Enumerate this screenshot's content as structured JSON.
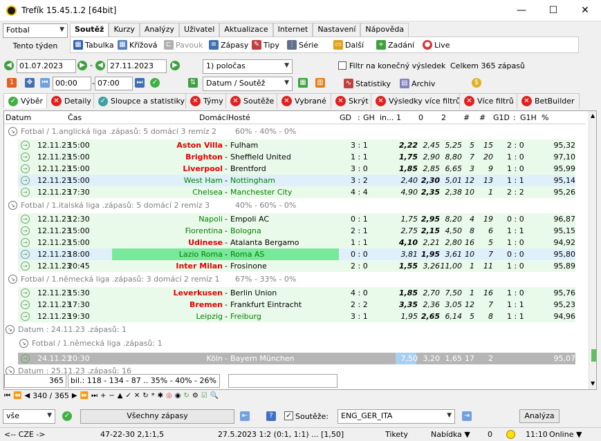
{
  "window": {
    "title": "Trefík 15.45.1.2 [64bit]"
  },
  "sport_select": "Fotbal",
  "period_button": "Tento týden",
  "menu_tabs": [
    "Soutěž",
    "Kurzy",
    "Analýzy",
    "Uživatel",
    "Aktualizace",
    "Internet",
    "Nastavení",
    "Nápověda"
  ],
  "toolbar": {
    "tabulka": "Tabulka",
    "krizova": "Křížová",
    "pavouk": "Pavouk",
    "zapasy": "Zápasy",
    "tipy": "Tipy",
    "serie": "Série",
    "dalsi": "Další",
    "zadani": "Zadání",
    "live": "Live"
  },
  "filters": {
    "date_from": "01.07.2023",
    "date_to": "27.11.2023",
    "time_from": "00:00",
    "time_to": "07:00",
    "half_select": "1) poločas",
    "sort_select": "Datum / Soutěž",
    "final_result_filter": "Filtr na konečný výsledek",
    "total": "Celkem 365 zápasů",
    "statistiky": "Statistiky",
    "archiv": "Archiv"
  },
  "result_tabs": [
    "Výběr",
    "Detaily",
    "Sloupce a statistiky",
    "Týmy",
    "Soutěže",
    "Vybrané",
    "Skrýt",
    "Výsledky více filtrů",
    "Více filtrů",
    "BetBuilder"
  ],
  "columns": [
    "Datum",
    "Čas",
    "Domácí",
    "Hosté",
    "GD",
    ":",
    "GH",
    "in...",
    "1",
    "0",
    "2",
    "#",
    "#",
    "G1D",
    ":",
    "G1H",
    "%"
  ],
  "groups": [
    {
      "label": "Fotbal / 1.anglická liga .zápasů: 5  domácí 3  remíz 2",
      "pct": "60% - 40% - 0%"
    },
    {
      "label": "Fotbal / 1.italská liga .zápasů: 5  domácí 2  remíz 3",
      "pct": "40% - 60% - 0%"
    },
    {
      "label": "Fotbal / 1.německá liga .zápasů: 3  domácí 2  remíz 1",
      "pct": "67% - 33% - 0%"
    }
  ],
  "date_group": "Datum : 24.11.23 .zápasů: 1",
  "date_group2": "Datum : 25.11.23 .zápasů: 16",
  "group4": "Fotbal / 1.německá liga .zápasů: 1",
  "matches": [
    [
      "12.11.23",
      "15:00",
      "Aston Villa",
      "Fulham",
      "3 : 1",
      "2,22",
      "2,45",
      "5,25",
      "5",
      "15",
      "2 : 0",
      "95,32"
    ],
    [
      "12.11.23",
      "15:00",
      "Brighton",
      "Sheffield United",
      "1 : 1",
      "1,75",
      "2,90",
      "8,80",
      "7",
      "20",
      "1 : 0",
      "97,10"
    ],
    [
      "12.11.23",
      "15:00",
      "Liverpool",
      "Brentford",
      "3 : 0",
      "1,85",
      "2,85",
      "6,65",
      "3",
      "9",
      "1 : 0",
      "95,99"
    ],
    [
      "12.11.23",
      "15:00",
      "West Ham",
      "Nottingham",
      "3 : 2",
      "2,40",
      "2,30",
      "5,01",
      "12",
      "13",
      "1 : 1",
      "95,14"
    ],
    [
      "12.11.23",
      "17:30",
      "Chelsea",
      "Manchester City",
      "4 : 4",
      "4,90",
      "2,35",
      "2,38",
      "10",
      "1",
      "2 : 2",
      "95,26"
    ],
    [
      "12.11.23",
      "12:30",
      "Napoli",
      "Empoli AC",
      "0 : 1",
      "1,75",
      "2,95",
      "8,20",
      "4",
      "19",
      "0 : 0",
      "96,87"
    ],
    [
      "12.11.23",
      "15:00",
      "Fiorentina",
      "Bologna",
      "2 : 1",
      "2,75",
      "2,15",
      "4,50",
      "8",
      "6",
      "1 : 1",
      "95,15"
    ],
    [
      "12.11.23",
      "15:00",
      "Udinese",
      "Atalanta Bergamo",
      "1 : 1",
      "4,10",
      "2,21",
      "2,80",
      "16",
      "5",
      "1 : 0",
      "94,92"
    ],
    [
      "12.11.23",
      "18:00",
      "Lazio Roma",
      "Roma AS",
      "0 : 0",
      "3,81",
      "1,95",
      "3,61",
      "10",
      "7",
      "0 : 0",
      "95,80"
    ],
    [
      "12.11.23",
      "20:45",
      "Inter Milan",
      "Frosinone",
      "2 : 0",
      "1,55",
      "3,26",
      "11,00",
      "1",
      "11",
      "1 : 0",
      "95,89"
    ],
    [
      "12.11.23",
      "15:30",
      "Leverkusen",
      "Berlin Union",
      "4 : 0",
      "1,85",
      "2,70",
      "7,50",
      "1",
      "16",
      "1 : 0",
      "95,76"
    ],
    [
      "12.11.23",
      "17:30",
      "Bremen",
      "Frankfurt Eintracht",
      "2 : 2",
      "3,35",
      "2,36",
      "3,05",
      "12",
      "7",
      "1 : 1",
      "95,23"
    ],
    [
      "12.11.23",
      "19:30",
      "Leipzig",
      "Freiburg",
      "3 : 1",
      "1,95",
      "2,65",
      "6,14",
      "5",
      "8",
      "1 : 1",
      "94,96"
    ],
    [
      "24.11.23",
      "20:30",
      "Köln",
      "Bayern München",
      "",
      "7,50",
      "3,20",
      "1,65",
      "17",
      "2",
      "",
      "95,07"
    ]
  ],
  "summary": {
    "count": "365",
    "bil": "bil.: 118 - 134 - 87 .. 35% - 40% - 26%"
  },
  "nav": {
    "position": "340 / 365"
  },
  "bottom": {
    "filter_select": "vše",
    "all_matches": "Všechny zápasy",
    "host": "Hosté",
    "competitions_check": "Soutěže:",
    "competitions_select": "ENG_GER_ITA",
    "analysis": "Analýza"
  },
  "statusbar": {
    "lang": "<-- CZE ->",
    "ratio": "47-22-30  2,1:1,5",
    "last": "27.5.2023 1:2 (0:1, 1:1) ... [1,50]",
    "tikety": "Tikety",
    "nabidka": "Nabídka ▼",
    "zero": "0",
    "time": "11:10",
    "online": "Online ▼"
  }
}
